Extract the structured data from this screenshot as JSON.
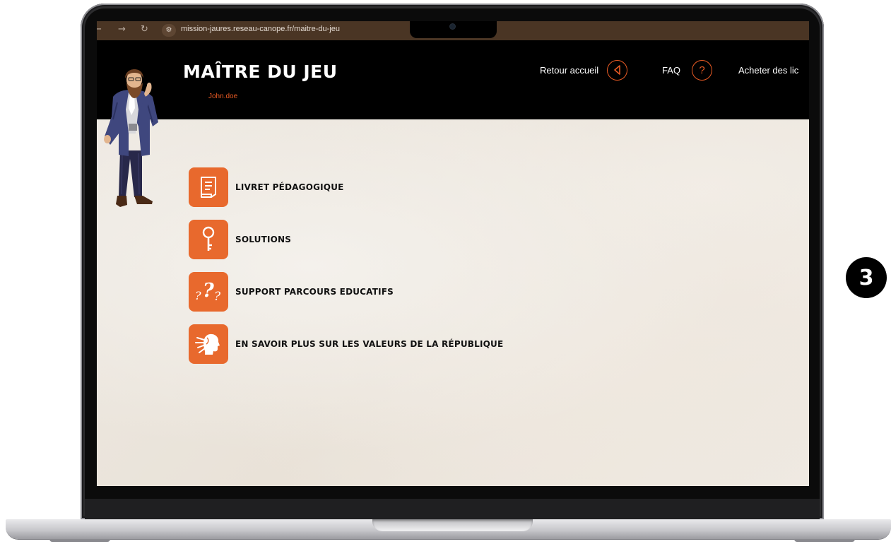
{
  "browser": {
    "back_icon": "back-arrow-icon",
    "forward_icon": "forward-arrow-icon",
    "reload_icon": "reload-icon",
    "url": "mission-jaures.reseau-canope.fr/maitre-du-jeu"
  },
  "header": {
    "title": "MAÎTRE DU JEU",
    "username": "John.doe",
    "nav": [
      {
        "label": "Retour accueil",
        "icon": "back-triangle-icon"
      },
      {
        "label": "FAQ",
        "icon": "question-icon"
      },
      {
        "label": "Acheter des lic"
      }
    ]
  },
  "menu": [
    {
      "label": "LIVRET PÉDAGOGIQUE",
      "icon": "booklet-icon"
    },
    {
      "label": "SOLUTIONS",
      "icon": "key-icon"
    },
    {
      "label": "SUPPORT PARCOURS EDUCATIFS",
      "icon": "question-marks-icon"
    },
    {
      "label": "EN SAVOIR PLUS SUR LES VALEURS DE LA RÉPUBLIQUE",
      "icon": "marianne-icon"
    }
  ],
  "step_badge": "3",
  "colors": {
    "accent": "#e8692d",
    "header_bg": "#000000",
    "username": "#e85a24",
    "browser_bar": "#4a3524"
  }
}
